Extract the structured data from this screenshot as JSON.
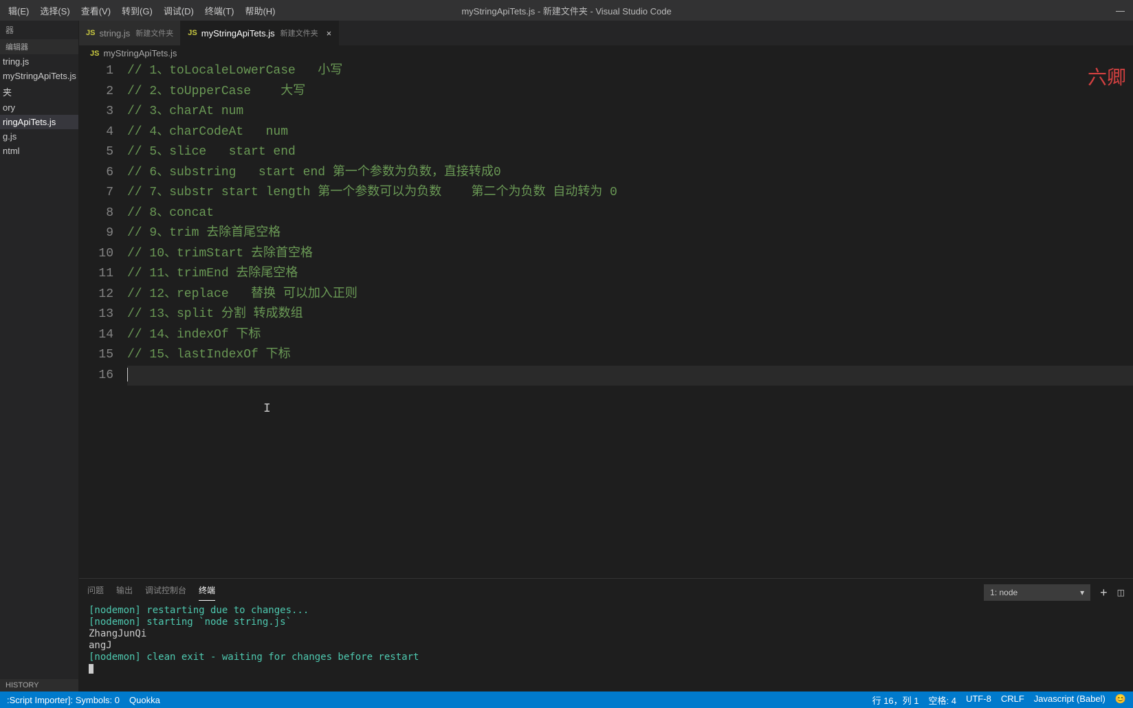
{
  "menu": [
    "辑(E)",
    "选择(S)",
    "查看(V)",
    "转到(G)",
    "调试(D)",
    "终端(T)",
    "帮助(H)"
  ],
  "window_title": "myStringApiTets.js - 新建文件夹 - Visual Studio Code",
  "sidebar": {
    "header1": "器",
    "section1": "编辑器",
    "files": [
      "tring.js",
      "myStringApiTets.js",
      "夹",
      "ory",
      "ringApiTets.js",
      "g.js",
      "ntml"
    ],
    "active_index": 4,
    "history_label": "HISTORY"
  },
  "tabs": [
    {
      "icon": "JS",
      "name": "string.js",
      "folder": "新建文件夹",
      "active": false
    },
    {
      "icon": "JS",
      "name": "myStringApiTets.js",
      "folder": "新建文件夹",
      "active": true
    }
  ],
  "breadcrumb": {
    "icon": "JS",
    "name": "myStringApiTets.js"
  },
  "watermark": "六卿",
  "code": [
    {
      "n": 1,
      "text": "// 1、toLocaleLowerCase   小写"
    },
    {
      "n": 2,
      "text": "// 2、toUpperCase    大写"
    },
    {
      "n": 3,
      "text": "// 3、charAt num"
    },
    {
      "n": 4,
      "text": "// 4、charCodeAt   num"
    },
    {
      "n": 5,
      "text": "// 5、slice   start end"
    },
    {
      "n": 6,
      "text": "// 6、substring   start end 第一个参数为负数，直接转成0"
    },
    {
      "n": 7,
      "text": "// 7、substr start length 第一个参数可以为负数    第二个为负数 自动转为 0"
    },
    {
      "n": 8,
      "text": "// 8、concat"
    },
    {
      "n": 9,
      "text": "// 9、trim 去除首尾空格"
    },
    {
      "n": 10,
      "text": "// 10、trimStart 去除首空格"
    },
    {
      "n": 11,
      "text": "// 11、trimEnd 去除尾空格"
    },
    {
      "n": 12,
      "text": "// 12、replace   替换 可以加入正则"
    },
    {
      "n": 13,
      "text": "// 13、split 分割 转成数组"
    },
    {
      "n": 14,
      "text": "// 14、indexOf 下标"
    },
    {
      "n": 15,
      "text": "// 15、lastIndexOf 下标"
    },
    {
      "n": 16,
      "text": ""
    }
  ],
  "panel": {
    "tabs": [
      "问题",
      "输出",
      "调试控制台",
      "终端"
    ],
    "active_tab": 3,
    "select_value": "1: node",
    "lines": [
      {
        "cls": "term-green",
        "text": "[nodemon] restarting due to changes..."
      },
      {
        "cls": "term-green",
        "text": "[nodemon] starting `node string.js`"
      },
      {
        "cls": "term-plain",
        "text": "ZhangJunQi"
      },
      {
        "cls": "term-plain",
        "text": "angJ"
      },
      {
        "cls": "term-green",
        "text": "[nodemon] clean exit - waiting for changes before restart"
      }
    ]
  },
  "status": {
    "left": [
      ":Script Importer]: Symbols: 0",
      "Quokka"
    ],
    "right": [
      "行 16，列 1",
      "空格: 4",
      "UTF-8",
      "CRLF",
      "Javascript (Babel)",
      "😊"
    ]
  }
}
